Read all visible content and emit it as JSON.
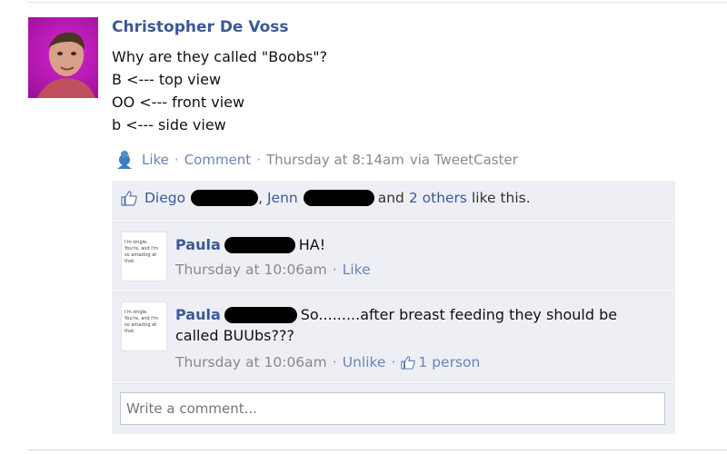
{
  "post": {
    "author": "Christopher De Voss",
    "lines": [
      "Why are they called \"Boobs\"?",
      "B <--- top view",
      "OO <--- front view",
      "b <--- side view"
    ],
    "actions": {
      "like": "Like",
      "comment": "Comment",
      "timestamp": "Thursday at 8:14am",
      "via": "via TweetCaster"
    }
  },
  "likes": {
    "name1": "Diego",
    "name2": "Jenn",
    "and": "and",
    "others": "2 others",
    "suffix": "like this."
  },
  "comments": [
    {
      "author": "Paula",
      "text": "HA!",
      "timestamp": "Thursday at 10:06am",
      "action": "Like",
      "avatar_text": "I'm single. You're, and I'm so amazing at that."
    },
    {
      "author": "Paula",
      "text_line1": "So.........after breast feeding they should be",
      "text_line2": "called BUUbs???",
      "timestamp": "Thursday at 10:06am",
      "action": "Unlike",
      "like_count": "1 person",
      "avatar_text": "I'm single. You're, and I'm so amazing at that."
    }
  ],
  "composer": {
    "placeholder": "Write a comment..."
  },
  "colors": {
    "link": "#3b5998",
    "ufi_bg": "#edeff4",
    "muted": "#8a8a8a"
  }
}
